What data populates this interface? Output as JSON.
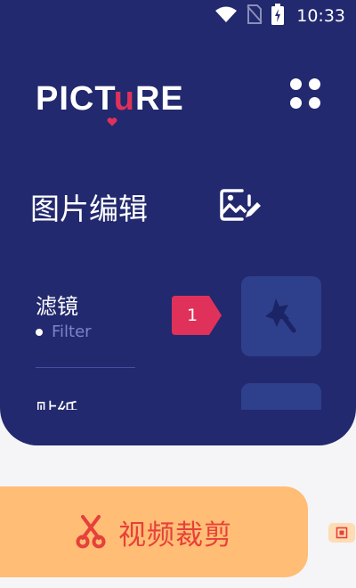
{
  "status_bar": {
    "time": "10:33",
    "icons": [
      "wifi-icon",
      "no-sim-icon",
      "battery-icon"
    ]
  },
  "header": {
    "logo_text": "PICTURE",
    "menu_icon": "grid-icon"
  },
  "section": {
    "title": "图片编辑",
    "icon": "image-edit-icon"
  },
  "list": {
    "items": [
      {
        "label": "滤镜",
        "sub": "Filter",
        "badge": "1",
        "icon": "magic-wand-icon"
      },
      {
        "label": "贴纸",
        "icon": "sticker-icon"
      }
    ]
  },
  "action": {
    "label": "视频裁剪",
    "icon": "scissors-icon"
  },
  "colors": {
    "primary": "#22296e",
    "accent": "#e0315a",
    "button": "#ffbd75",
    "button_text": "#e7403a",
    "tile": "#2e3f8c"
  }
}
